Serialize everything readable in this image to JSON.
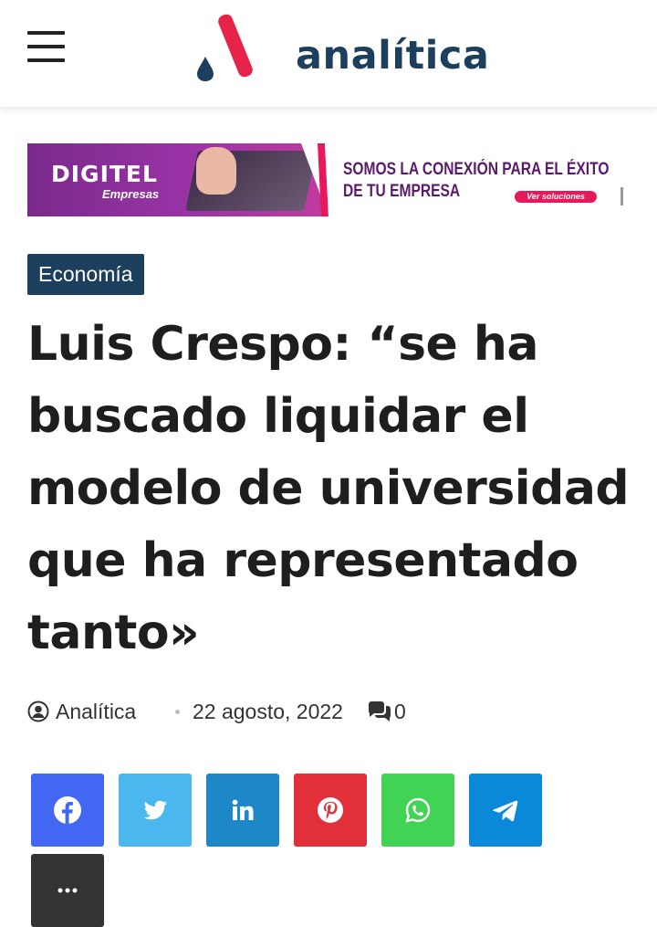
{
  "header": {
    "logo_text": "analítica",
    "brand_colors": {
      "primary": "#1c3f5e",
      "accent": "#e8234a"
    }
  },
  "ad": {
    "brand": "DIGITEL",
    "brand_sub": "Empresas",
    "headline_line1": "SOMOS LA CONEXIÓN PARA EL ÉXITO",
    "headline_line2": "DE TU EMPRESA",
    "cta": "Ver soluciones"
  },
  "article": {
    "category": "Economía",
    "title": "Luis Crespo: “se ha buscado liquidar el modelo de universidad que ha representado tanto»",
    "author": "Analítica",
    "date": "22 agosto, 2022",
    "comments_count": "0"
  },
  "share_buttons": [
    {
      "name": "facebook",
      "icon": "facebook-icon",
      "color": "#4267f2"
    },
    {
      "name": "twitter",
      "icon": "twitter-icon",
      "color": "#4ab7ef"
    },
    {
      "name": "linkedin",
      "icon": "linkedin-icon",
      "color": "#1d87c7"
    },
    {
      "name": "pinterest",
      "icon": "pinterest-icon",
      "color": "#e1303a"
    },
    {
      "name": "whatsapp",
      "icon": "whatsapp-icon",
      "color": "#41d354"
    },
    {
      "name": "telegram",
      "icon": "telegram-icon",
      "color": "#0a89d8"
    },
    {
      "name": "more",
      "icon": "more-icon",
      "color": "#333333"
    }
  ]
}
